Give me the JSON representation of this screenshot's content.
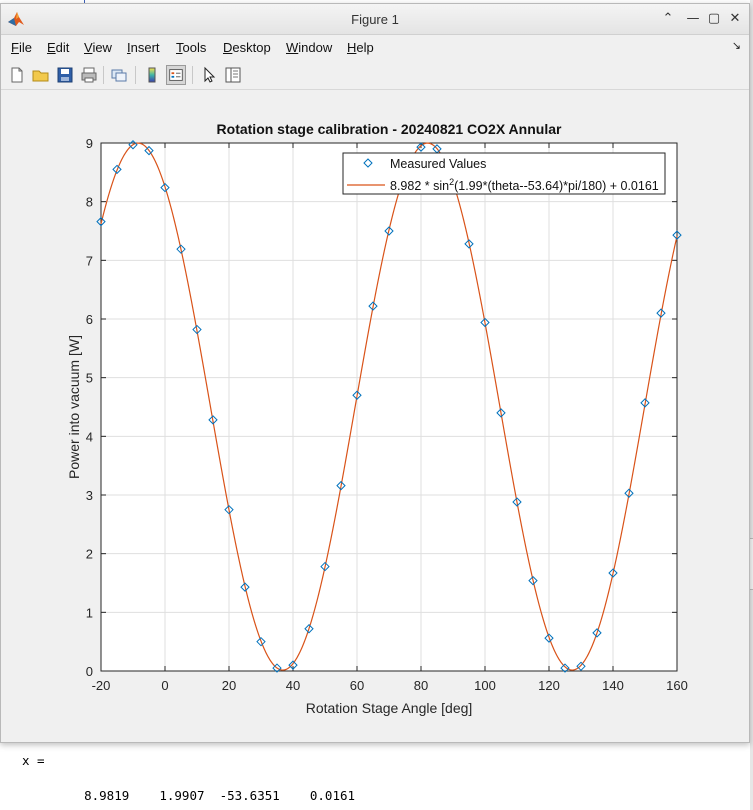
{
  "window": {
    "title": "Figure 1",
    "controls": {
      "collapse": "⌃",
      "minimize": "—",
      "maximize": "▢",
      "close": "✕"
    }
  },
  "menu": {
    "items": [
      {
        "label": "File",
        "key": "F",
        "rest": "ile"
      },
      {
        "label": "Edit",
        "key": "E",
        "rest": "dit"
      },
      {
        "label": "View",
        "key": "V",
        "rest": "iew"
      },
      {
        "label": "Insert",
        "key": "I",
        "rest": "nsert"
      },
      {
        "label": "Tools",
        "key": "T",
        "rest": "ools"
      },
      {
        "label": "Desktop",
        "key": "D",
        "rest": "esktop"
      },
      {
        "label": "Window",
        "key": "W",
        "rest": "indow"
      },
      {
        "label": "Help",
        "key": "H",
        "rest": "elp"
      }
    ],
    "dock_glyph": "↘"
  },
  "toolbar": {
    "icons": [
      "new-figure-icon",
      "open-file-icon",
      "save-icon",
      "print-icon",
      "link-plot-icon",
      "colorbar-icon",
      "legend-icon",
      "edit-plot-icon",
      "property-inspector-icon"
    ]
  },
  "command_window": {
    "var_line": "x =",
    "values_line": "    8.9819    1.9907  -53.6351    0.0161"
  },
  "colors": {
    "marker": "#0072bd",
    "fit_line": "#d95319",
    "grid": "#dfdfdf",
    "axes": "#262626"
  },
  "chart_data": {
    "type": "line",
    "title": "Rotation stage calibration - 20240821 CO2X Annular",
    "xlabel": "Rotation Stage Angle [deg]",
    "ylabel": "Power into vacuum [W]",
    "xlim": [
      -20,
      160
    ],
    "ylim": [
      0,
      9
    ],
    "xticks": [
      -20,
      0,
      20,
      40,
      60,
      80,
      100,
      120,
      140,
      160
    ],
    "yticks": [
      0,
      1,
      2,
      3,
      4,
      5,
      6,
      7,
      8,
      9
    ],
    "grid": true,
    "legend_position": "top-right",
    "series": [
      {
        "name": "Measured Values",
        "style": "markers",
        "marker": "diamond",
        "x": [
          -20,
          -15,
          -10,
          -5,
          0,
          5,
          10,
          15,
          20,
          25,
          30,
          35,
          40,
          45,
          50,
          55,
          60,
          65,
          70,
          75,
          80,
          85,
          90,
          95,
          100,
          105,
          110,
          115,
          120,
          125,
          130,
          135,
          140,
          145,
          150,
          155,
          160
        ],
        "y": [
          7.66,
          8.55,
          8.97,
          8.87,
          8.24,
          7.19,
          5.82,
          4.28,
          2.75,
          1.43,
          0.5,
          0.05,
          0.1,
          0.72,
          1.78,
          3.16,
          4.7,
          6.22,
          7.5,
          8.44,
          8.93,
          8.9,
          8.36,
          7.28,
          5.94,
          4.4,
          2.88,
          1.54,
          0.56,
          0.05,
          0.08,
          0.65,
          1.67,
          3.03,
          4.57,
          6.1,
          7.43
        ]
      },
      {
        "name": "8.982 * sin²(1.99*(theta--53.64)*pi/180) + 0.0161",
        "legend_prefix": "8.982 * sin",
        "legend_sup": "2",
        "legend_suffix": "(1.99*(theta--53.64)*pi/180) + 0.0161",
        "style": "line",
        "function": {
          "a": 8.982,
          "b": 1.99,
          "c": -53.64,
          "d": 0.0161
        }
      }
    ]
  }
}
